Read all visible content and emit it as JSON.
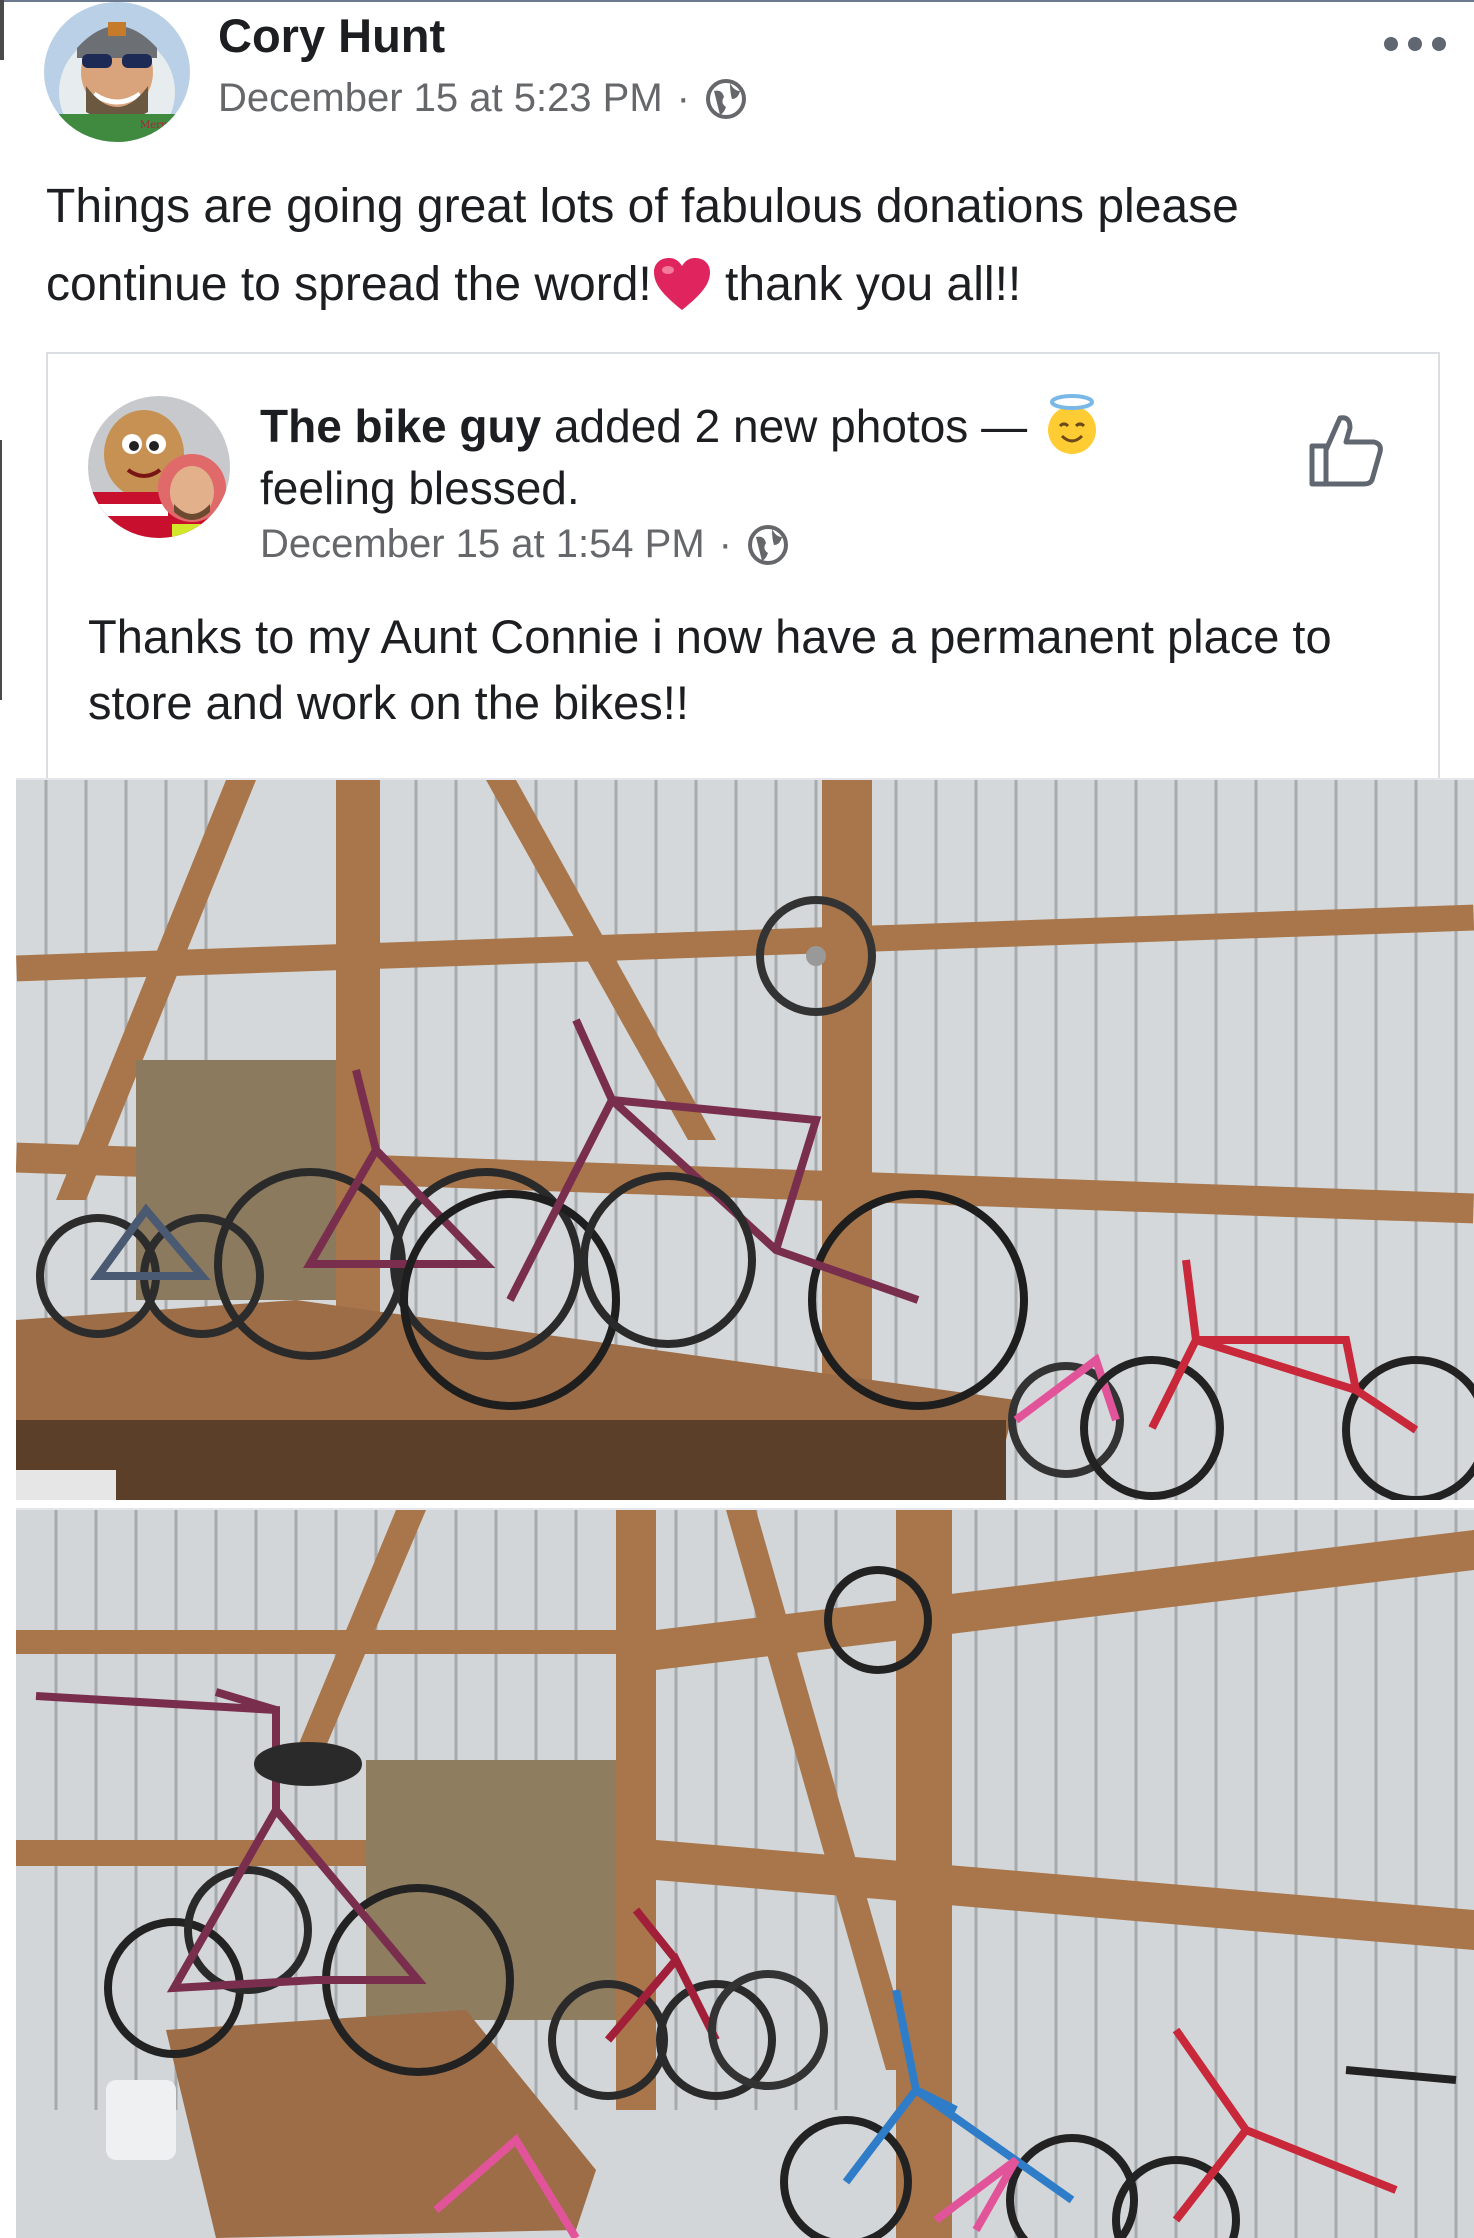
{
  "post": {
    "author": "Cory Hunt",
    "timestamp": "December 15 at 5:23 PM",
    "separator": "·",
    "privacy_icon": "globe-icon",
    "text_line1": "Things are going great lots of fabulous donations please",
    "text_line2_a": "continue to spread the word!",
    "text_line2_b": " thank you all!!",
    "emoji": "heart-icon"
  },
  "shared_post": {
    "author": "The bike guy",
    "action": " added 2 new photos — ",
    "feeling": "feeling blessed.",
    "feeling_icon": "smiling-face-with-halo-icon",
    "timestamp": "December 15 at 1:54 PM",
    "separator": "·",
    "privacy_icon": "globe-icon",
    "text": "Thanks to my Aunt Connie i now have a permanent place to store and work on the bikes!!"
  },
  "photos": [
    {
      "name": "photo-bikes-on-bench"
    },
    {
      "name": "photo-bikes-in-shed"
    }
  ],
  "colors": {
    "text": "#1c1e21",
    "meta": "#65676b",
    "heart": "#e0245e",
    "wood": "#a8764a",
    "metal": "#c9ccce",
    "bike_purple": "#7a2e4e",
    "bike_red": "#c8283a",
    "bike_blue": "#2f7dc9",
    "bike_pink": "#e2549a"
  }
}
